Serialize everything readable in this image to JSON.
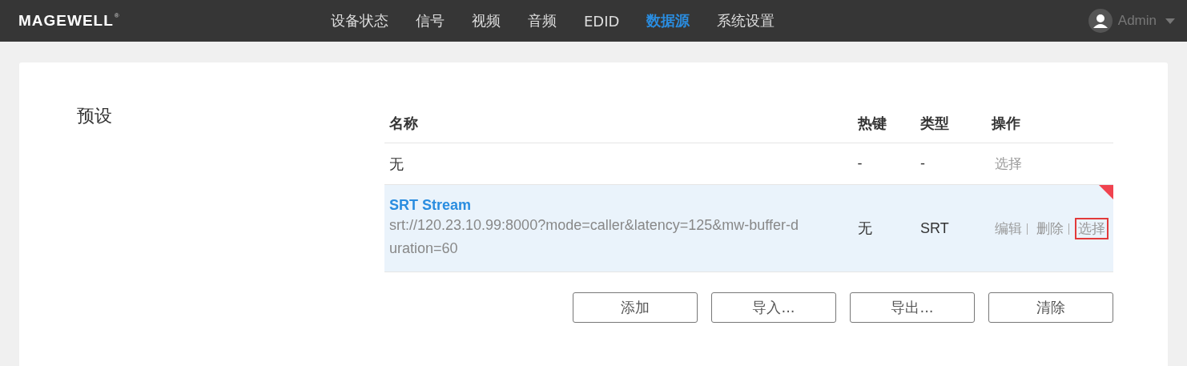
{
  "header": {
    "logo": "MAGEWELL",
    "logo_mark": "®",
    "nav": [
      {
        "label": "设备状态",
        "selected": false
      },
      {
        "label": "信号",
        "selected": false
      },
      {
        "label": "视频",
        "selected": false
      },
      {
        "label": "音频",
        "selected": false
      },
      {
        "label": "EDID",
        "selected": false
      },
      {
        "label": "数据源",
        "selected": true
      },
      {
        "label": "系统设置",
        "selected": false
      }
    ],
    "user": "Admin"
  },
  "section": {
    "title": "预设",
    "table": {
      "columns": [
        "名称",
        "热键",
        "类型",
        "操作"
      ],
      "rows": [
        {
          "name": "无",
          "url": null,
          "hotkey": "-",
          "type": "-",
          "selected": false,
          "actions": [
            {
              "label": "选择",
              "highlighted": false
            }
          ]
        },
        {
          "name": "SRT Stream",
          "url": "srt://120.23.10.99:8000?mode=caller&latency=125&mw-buffer-duration=60",
          "hotkey": "无",
          "type": "SRT",
          "selected": true,
          "actions": [
            {
              "label": "编辑",
              "highlighted": false
            },
            {
              "label": "删除",
              "highlighted": false
            },
            {
              "label": "选择",
              "highlighted": true
            }
          ]
        }
      ]
    },
    "buttons": [
      "添加",
      "导入...",
      "导出...",
      "清除"
    ]
  }
}
